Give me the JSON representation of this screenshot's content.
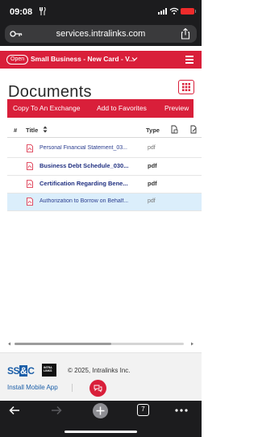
{
  "status_bar": {
    "time": "09:08"
  },
  "browser": {
    "url": "services.intralinks.com"
  },
  "workspace": {
    "status_pill": "Open",
    "name": "Small Business - New Card - V..."
  },
  "page": {
    "title": "Documents"
  },
  "actions": {
    "copy": "Copy To An Exchange",
    "favorites": "Add to Favorites",
    "preview": "Preview"
  },
  "table": {
    "headers": {
      "number": "#",
      "title": "Title",
      "type": "Type"
    },
    "rows": [
      {
        "name": "Personal Financial Statement_03...",
        "type": "pdf",
        "unread": false,
        "selected": false
      },
      {
        "name": "Business Debt Schedule_030...",
        "type": "pdf",
        "unread": true,
        "selected": false
      },
      {
        "name": "Certification Regarding Bene...",
        "type": "pdf",
        "unread": true,
        "selected": false
      },
      {
        "name": "Authorization to Borrow on Behalf...",
        "type": "pdf",
        "unread": false,
        "selected": true
      }
    ]
  },
  "footer": {
    "ssc_logo": "SS&C",
    "intralinks_logo": "INTRA LINKS",
    "copyright": "© 2025, Intralinks Inc.",
    "mobile_app": "Install Mobile App"
  },
  "bottom_nav": {
    "tab_count": "7"
  },
  "colors": {
    "brand_red": "#d91f3a",
    "link_blue": "#2a3d8f",
    "selected_row": "#dbeefb"
  }
}
